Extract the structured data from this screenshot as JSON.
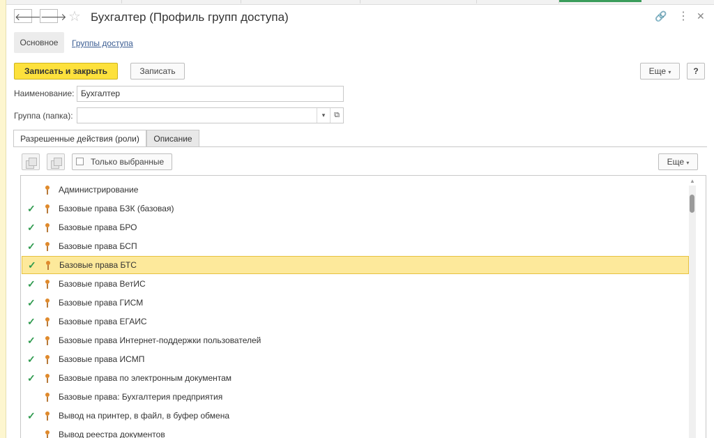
{
  "window": {
    "title": "Бухгалтер (Профиль групп доступа)",
    "back_icon": "arrow-left-icon",
    "forward_icon": "arrow-right-icon",
    "favorite_icon": "star-icon",
    "link_icon": "link-icon",
    "menu_icon": "more-vert-icon",
    "close_icon": "close-icon"
  },
  "nav": {
    "main_label": "Основное",
    "groups_link": "Группы доступа"
  },
  "toolbar": {
    "save_close_label": "Записать и закрыть",
    "save_label": "Записать",
    "more_label": "Еще",
    "help_label": "?"
  },
  "form": {
    "name_label": "Наименование:",
    "name_value": "Бухгалтер",
    "group_label": "Группа (папка):",
    "group_value": ""
  },
  "tabs": [
    {
      "label": "Разрешенные действия (роли)",
      "active": true
    },
    {
      "label": "Описание",
      "active": false
    }
  ],
  "roles_toolbar": {
    "only_selected_label": "Только выбранные",
    "more_label": "Еще"
  },
  "roles": [
    {
      "label": "Администрирование",
      "checked": false,
      "selected": false
    },
    {
      "label": "Базовые права БЗК (базовая)",
      "checked": true,
      "selected": false
    },
    {
      "label": "Базовые права БРО",
      "checked": true,
      "selected": false
    },
    {
      "label": "Базовые права БСП",
      "checked": true,
      "selected": false
    },
    {
      "label": "Базовые права БТС",
      "checked": true,
      "selected": true
    },
    {
      "label": "Базовые права ВетИС",
      "checked": true,
      "selected": false
    },
    {
      "label": "Базовые права ГИСМ",
      "checked": true,
      "selected": false
    },
    {
      "label": "Базовые права ЕГАИС",
      "checked": true,
      "selected": false
    },
    {
      "label": "Базовые права Интернет-поддержки пользователей",
      "checked": true,
      "selected": false
    },
    {
      "label": "Базовые права ИСМП",
      "checked": true,
      "selected": false
    },
    {
      "label": "Базовые права по электронным документам",
      "checked": true,
      "selected": false
    },
    {
      "label": "Базовые права: Бухгалтерия предприятия",
      "checked": false,
      "selected": false
    },
    {
      "label": "Вывод на принтер, в файл, в буфер обмена",
      "checked": true,
      "selected": false
    },
    {
      "label": "Вывод реестра документов",
      "checked": false,
      "selected": false
    }
  ],
  "colors": {
    "accent_yellow": "#fde13c",
    "selected_row": "#fde99b",
    "check_green": "#2e9a4e",
    "link_blue": "#3a5c92"
  }
}
